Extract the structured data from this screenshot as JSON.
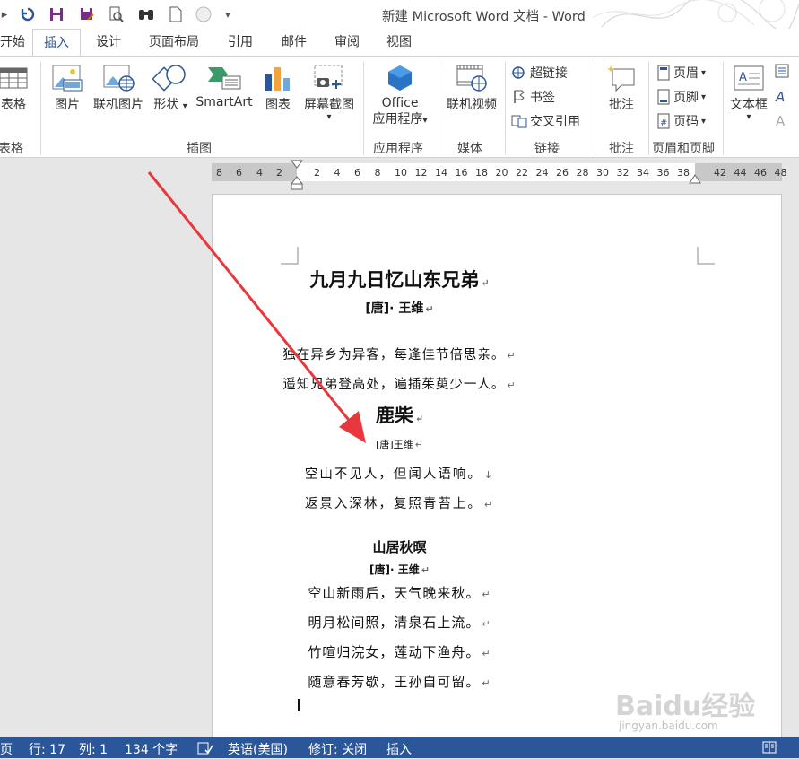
{
  "window": {
    "title": "新建 Microsoft Word 文档 - Word"
  },
  "qat": {
    "more": "▾"
  },
  "tabs": [
    "开始",
    "插入",
    "设计",
    "页面布局",
    "引用",
    "邮件",
    "审阅",
    "视图"
  ],
  "ribbon": {
    "table_label": "表格",
    "picture": "图片",
    "online_picture": "联机图片",
    "shapes": "形状",
    "smartart": "SmartArt",
    "chart": "图表",
    "screenshot": "屏幕截图",
    "office_line1": "Office",
    "office_line2": "应用程序",
    "online_video": "联机视频",
    "hyperlink": "超链接",
    "bookmark": "书签",
    "crossref": "交叉引用",
    "comment": "批注",
    "header": "页眉",
    "footer": "页脚",
    "page_number": "页码",
    "textbox": "文本框",
    "dropdown": "▾",
    "groups": {
      "table": "表格",
      "illustrations": "插图",
      "apps": "应用程序",
      "media": "媒体",
      "links": "链接",
      "comments": "批注",
      "header_footer": "页眉和页脚"
    }
  },
  "ruler": {
    "left": [
      "8",
      "6",
      "4",
      "2"
    ],
    "right": [
      "2",
      "4",
      "6",
      "8",
      "10",
      "12",
      "14",
      "16",
      "18",
      "20",
      "22",
      "24",
      "26",
      "28",
      "30",
      "32",
      "34",
      "36",
      "38"
    ],
    "margin": [
      "42",
      "44",
      "46",
      "48"
    ]
  },
  "document": {
    "poem1": {
      "title": "九月九日忆山东兄弟",
      "author": "[唐]· 王维",
      "lines": [
        "独在异乡为异客，每逢佳节倍思亲。",
        "遥知兄弟登高处，遍插茱萸少一人。"
      ]
    },
    "poem2": {
      "title": "鹿柴",
      "author": "[唐]王维",
      "lines": [
        "空山不见人，但闻人语响。",
        "返景入深林，复照青苔上。"
      ]
    },
    "poem3": {
      "title": "山居秋暝",
      "author": "[唐]· 王维",
      "lines": [
        "空山新雨后，天气晚来秋。",
        "明月松间照，清泉石上流。",
        "竹喧归浣女，莲动下渔舟。",
        "随意春芳歇，王孙自可留。"
      ]
    },
    "para_mark": "↵",
    "down_mark": "↓"
  },
  "status": {
    "page": "页",
    "row": "行: 17",
    "col": "列: 1",
    "words": "134 个字",
    "language": "英语(美国)",
    "track": "修订: 关闭",
    "mode": "插入"
  },
  "watermark": {
    "text": "Baidu经验",
    "url": "jingyan.baidu.com"
  },
  "colors": {
    "accent": "#2b579a",
    "arrow": "#e8383d"
  }
}
